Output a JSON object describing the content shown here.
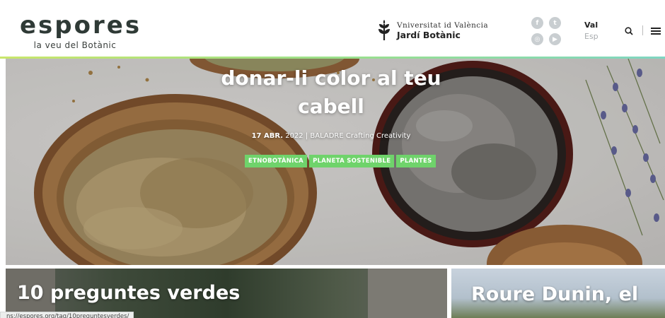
{
  "header": {
    "logo": {
      "word": "espores",
      "tagline": "la veu del Botànic"
    },
    "institution": {
      "line1": "Vniversitat id València",
      "line2": "Jardí Botànic"
    },
    "social": [
      {
        "icon": "facebook-icon",
        "glyph": "f"
      },
      {
        "icon": "twitter-icon",
        "glyph": "t"
      },
      {
        "icon": "instagram-icon",
        "glyph": "◎"
      },
      {
        "icon": "youtube-icon",
        "glyph": "▶"
      }
    ],
    "languages": {
      "active": "Val",
      "other": "Esp"
    }
  },
  "hero": {
    "title_line1": "donar-li color al teu",
    "title_line2": "cabell",
    "date": "17 ABR.",
    "date_rest": " 2022 | BALADRE Crafting Creativity",
    "tags": [
      "ETNOBOTÀNICA",
      "PLANETA SOSTENIBLE",
      "PLANTES"
    ]
  },
  "cards": [
    {
      "title": "10 preguntes verdes"
    },
    {
      "title": "Roure Dunin, el"
    }
  ],
  "status_bar": {
    "url": "ns://espores.org/tag/10preguntesverdes/"
  },
  "colors": {
    "tag_green": "#6fd36b",
    "accent_start": "#c9e66b",
    "accent_end": "#7fd6c2",
    "logo_dark": "#2f3a36"
  }
}
